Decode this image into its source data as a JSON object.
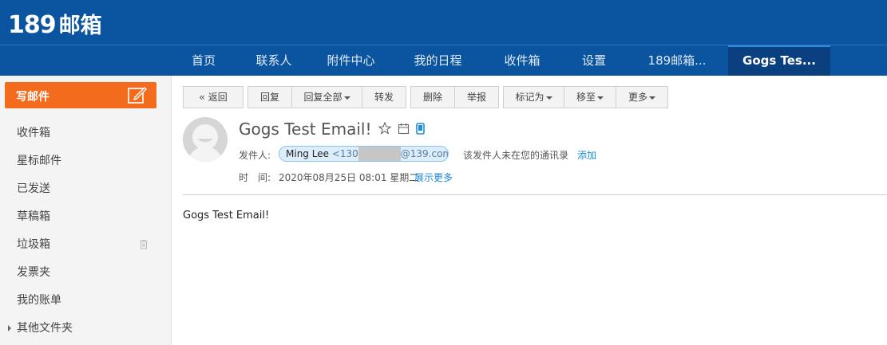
{
  "brand": {
    "number": "189",
    "text": "邮箱"
  },
  "nav": {
    "tabs": [
      {
        "label": "首页"
      },
      {
        "label": "联系人"
      },
      {
        "label": "附件中心"
      },
      {
        "label": "我的日程"
      },
      {
        "label": "收件箱"
      },
      {
        "label": "设置"
      },
      {
        "label": "189邮箱..."
      },
      {
        "label": "Gogs Tes..."
      }
    ],
    "active_tab": "Gogs Tes..."
  },
  "sidebar": {
    "compose_label": "写邮件",
    "items": [
      {
        "label": "收件箱"
      },
      {
        "label": "星标邮件"
      },
      {
        "label": "已发送"
      },
      {
        "label": "草稿箱"
      },
      {
        "label": "垃圾箱"
      },
      {
        "label": "发票夹"
      },
      {
        "label": "我的账单"
      },
      {
        "label": "其他文件夹"
      }
    ]
  },
  "toolbar": {
    "back": "返回",
    "reply": "回复",
    "reply_all": "回复全部",
    "forward": "转发",
    "delete": "删除",
    "report": "举报",
    "mark_as": "标记为",
    "move_to": "移至",
    "more": "更多"
  },
  "email": {
    "subject": "Gogs Test Email!",
    "from_label": "发件人:",
    "sender_name": "Ming Lee",
    "sender_addr_prefix": "<130",
    "sender_addr_suffix": "@139.com>",
    "not_in_contacts": "该发件人未在您的通讯录",
    "add_contact": "添加",
    "time_label": "时　间:",
    "time_value": "2020年08月25日 08:01 星期二",
    "show_more": "展示更多",
    "body": "Gogs Test Email!"
  },
  "colors": {
    "header_bg": "#0b55a0",
    "active_tab_bg": "#0a3f80",
    "compose_bg": "#f36b1c",
    "link": "#1e88d8",
    "sender_pill_bg": "#dcedfb",
    "phone_icon": "#1e90e0"
  }
}
